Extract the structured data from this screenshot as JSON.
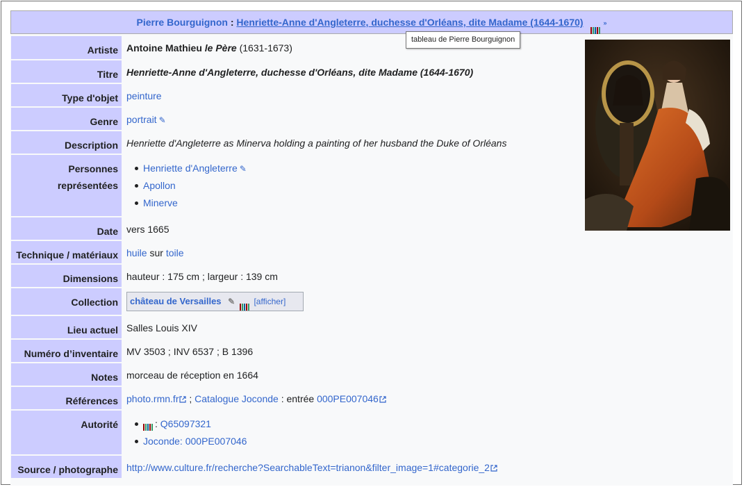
{
  "header": {
    "artist": "Pierre Bourguignon",
    "separator": " : ",
    "title": "Henriette-Anne d'Angleterre, duchesse d'Orléans, dite Madame (1644-1670)",
    "tooltip": "tableau de Pierre Bourguignon"
  },
  "rows": {
    "artiste": {
      "label": "Artiste",
      "name": "Antoine Mathieu",
      "epithet": "le Père",
      "years": " (1631-1673)"
    },
    "titre": {
      "label": "Titre",
      "value": "Henriette-Anne d'Angleterre, duchesse d'Orléans, dite Madame (1644-1670)"
    },
    "type": {
      "label": "Type d'objet",
      "value": "peinture"
    },
    "genre": {
      "label": "Genre",
      "value": "portrait"
    },
    "description": {
      "label": "Description",
      "value": "Henriette d'Angleterre as Minerva holding a painting of her husband the Duke of Orléans"
    },
    "personnes": {
      "label_1": "Personnes",
      "label_2": "représentées",
      "items": [
        "Henriette d'Angleterre",
        "Apollon",
        "Minerve"
      ]
    },
    "date": {
      "label": "Date",
      "value": "vers 1665"
    },
    "technique": {
      "label": "Technique / matériaux",
      "material_1": "huile",
      "joiner": " sur ",
      "material_2": "toile"
    },
    "dimensions": {
      "label": "Dimensions",
      "value": "hauteur : 175 cm ; largeur : 139 cm"
    },
    "collection": {
      "label": "Collection",
      "value": "château de Versailles",
      "show": "[afficher]"
    },
    "lieu": {
      "label": "Lieu actuel",
      "value": "Salles Louis XIV"
    },
    "inventaire": {
      "label": "Numéro d’inventaire",
      "value": "MV 3503 ; INV 6537 ; B 1396"
    },
    "notes": {
      "label": "Notes",
      "value": "morceau de réception en 1664"
    },
    "references": {
      "label": "Références",
      "ref_1": "photo.rmn.fr",
      "sep": " ; ",
      "ref_2": "Catalogue Joconde",
      "text": " : entrée ",
      "ref_3": "000PE007046"
    },
    "autorite": {
      "label": "Autorité",
      "wikidata_sep": ": ",
      "wikidata_id": "Q65097321",
      "joconde": "Joconde: 000PE007046"
    },
    "source": {
      "label": "Source / photographe",
      "value": "http://www.culture.fr/recherche?SearchableText=trianon&filter_image=1#categorie_2"
    }
  },
  "colors": {
    "label_bg": "#ccccff",
    "link": "#3366cc",
    "panel_bg": "#f8f9fa",
    "text": "#202122"
  },
  "icons": {
    "wikidata": "wikidata-barcode-icon",
    "edit": "pencil-icon",
    "external": "external-link-icon",
    "painting": "portrait-painting-thumbnail"
  }
}
